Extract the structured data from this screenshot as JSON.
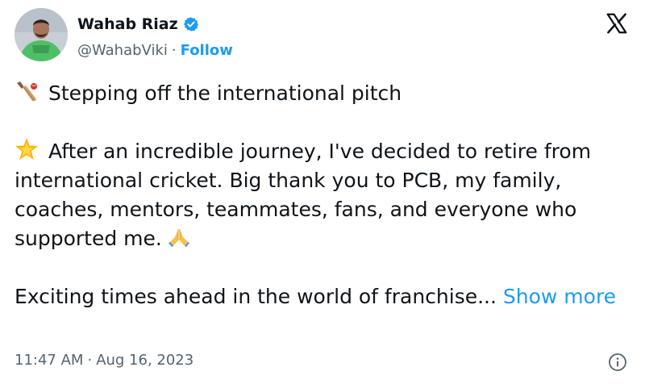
{
  "author": {
    "name": "Wahab Riaz",
    "handle": "@WahabViki",
    "follow_label": "Follow",
    "separator": "·"
  },
  "tweet": {
    "line1": "Stepping off the international pitch",
    "para2": "After an incredible journey, I've decided to retire from international cricket. Big thank you to PCB, my family, coaches, mentors, teammates, fans, and everyone who supported me.",
    "para3": "Exciting times ahead in the world of franchise...",
    "show_more": "Show more",
    "icons": [
      "cricket-bat-icon",
      "star-glow-icon",
      "folded-hands-icon"
    ]
  },
  "meta": {
    "time": "11:47 AM",
    "separator": "·",
    "date": "Aug 16, 2023"
  },
  "colors": {
    "accent": "#1d9bf0",
    "text": "#0f1419",
    "muted": "#536471"
  }
}
